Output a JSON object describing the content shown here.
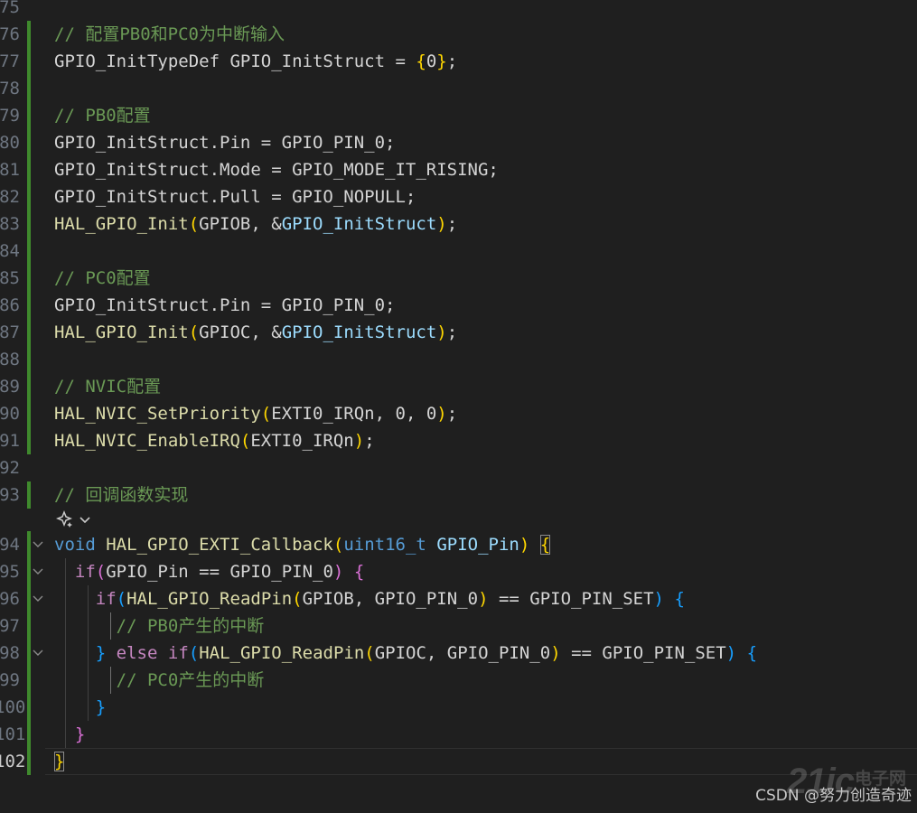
{
  "lines": [
    {
      "n": "75",
      "bar": false,
      "fold": false,
      "guides": [],
      "tokens": []
    },
    {
      "n": "76",
      "bar": true,
      "fold": false,
      "guides": [],
      "tokens": [
        {
          "t": "// 配置PB0和PC0为中断输入",
          "c": "comment"
        }
      ]
    },
    {
      "n": "77",
      "bar": true,
      "fold": false,
      "guides": [],
      "tokens": [
        {
          "t": "GPIO_InitTypeDef GPIO_InitStruct = ",
          "c": "op"
        },
        {
          "t": "{",
          "c": "b1"
        },
        {
          "t": "0",
          "c": "op"
        },
        {
          "t": "}",
          "c": "b1"
        },
        {
          "t": ";",
          "c": "op"
        }
      ]
    },
    {
      "n": "78",
      "bar": true,
      "fold": false,
      "guides": [],
      "tokens": []
    },
    {
      "n": "79",
      "bar": true,
      "fold": false,
      "guides": [],
      "tokens": [
        {
          "t": "// PB0配置",
          "c": "comment"
        }
      ]
    },
    {
      "n": "80",
      "bar": true,
      "fold": false,
      "guides": [],
      "tokens": [
        {
          "t": "GPIO_InitStruct.Pin = GPIO_PIN_0;",
          "c": "op"
        }
      ]
    },
    {
      "n": "81",
      "bar": true,
      "fold": false,
      "guides": [],
      "tokens": [
        {
          "t": "GPIO_InitStruct.Mode = GPIO_MODE_IT_RISING;",
          "c": "op"
        }
      ]
    },
    {
      "n": "82",
      "bar": true,
      "fold": false,
      "guides": [],
      "tokens": [
        {
          "t": "GPIO_InitStruct.Pull = GPIO_NOPULL;",
          "c": "op"
        }
      ]
    },
    {
      "n": "83",
      "bar": true,
      "fold": false,
      "guides": [],
      "tokens": [
        {
          "t": "HAL_GPIO_Init",
          "c": "func"
        },
        {
          "t": "(",
          "c": "b1"
        },
        {
          "t": "GPIOB, &",
          "c": "op"
        },
        {
          "t": "GPIO_InitStruct",
          "c": "var"
        },
        {
          "t": ")",
          "c": "b1"
        },
        {
          "t": ";",
          "c": "op"
        }
      ]
    },
    {
      "n": "84",
      "bar": true,
      "fold": false,
      "guides": [],
      "tokens": []
    },
    {
      "n": "85",
      "bar": true,
      "fold": false,
      "guides": [],
      "tokens": [
        {
          "t": "// PC0配置",
          "c": "comment"
        }
      ]
    },
    {
      "n": "86",
      "bar": true,
      "fold": false,
      "guides": [],
      "tokens": [
        {
          "t": "GPIO_InitStruct.Pin = GPIO_PIN_0;",
          "c": "op"
        }
      ]
    },
    {
      "n": "87",
      "bar": true,
      "fold": false,
      "guides": [],
      "tokens": [
        {
          "t": "HAL_GPIO_Init",
          "c": "func"
        },
        {
          "t": "(",
          "c": "b1"
        },
        {
          "t": "GPIOC, &",
          "c": "op"
        },
        {
          "t": "GPIO_InitStruct",
          "c": "var"
        },
        {
          "t": ")",
          "c": "b1"
        },
        {
          "t": ";",
          "c": "op"
        }
      ]
    },
    {
      "n": "88",
      "bar": true,
      "fold": false,
      "guides": [],
      "tokens": []
    },
    {
      "n": "89",
      "bar": true,
      "fold": false,
      "guides": [],
      "tokens": [
        {
          "t": "// NVIC配置",
          "c": "comment"
        }
      ]
    },
    {
      "n": "90",
      "bar": true,
      "fold": false,
      "guides": [],
      "tokens": [
        {
          "t": "HAL_NVIC_SetPriority",
          "c": "func"
        },
        {
          "t": "(",
          "c": "b1"
        },
        {
          "t": "EXTI0_IRQn, 0, 0",
          "c": "op"
        },
        {
          "t": ")",
          "c": "b1"
        },
        {
          "t": ";",
          "c": "op"
        }
      ]
    },
    {
      "n": "91",
      "bar": true,
      "fold": false,
      "guides": [],
      "tokens": [
        {
          "t": "HAL_NVIC_EnableIRQ",
          "c": "func"
        },
        {
          "t": "(",
          "c": "b1"
        },
        {
          "t": "EXTI0_IRQn",
          "c": "op"
        },
        {
          "t": ")",
          "c": "b1"
        },
        {
          "t": ";",
          "c": "op"
        }
      ]
    },
    {
      "n": "92",
      "bar": false,
      "fold": false,
      "guides": [],
      "tokens": []
    },
    {
      "n": "93",
      "bar": true,
      "fold": false,
      "guides": [],
      "tokens": [
        {
          "t": "// 回调函数实现",
          "c": "comment"
        }
      ]
    },
    {
      "n": "94",
      "bar": true,
      "fold": true,
      "guides": [],
      "tokens": [
        {
          "t": "void",
          "c": "kw"
        },
        {
          "t": " ",
          "c": "op"
        },
        {
          "t": "HAL_GPIO_EXTI_Callback",
          "c": "func"
        },
        {
          "t": "(",
          "c": "b1"
        },
        {
          "t": "uint16_t",
          "c": "kw"
        },
        {
          "t": " ",
          "c": "op"
        },
        {
          "t": "GPIO_Pin",
          "c": "var"
        },
        {
          "t": ")",
          "c": "b1"
        },
        {
          "t": " ",
          "c": "op"
        },
        {
          "t": "{",
          "c": "b1m"
        }
      ]
    },
    {
      "n": "95",
      "bar": true,
      "fold": true,
      "guides": [
        0
      ],
      "tokens": [
        {
          "t": "  ",
          "c": "op"
        },
        {
          "t": "if",
          "c": "ctrl"
        },
        {
          "t": "(",
          "c": "b2"
        },
        {
          "t": "GPIO_Pin == GPIO_PIN_0",
          "c": "op"
        },
        {
          "t": ")",
          "c": "b2"
        },
        {
          "t": " ",
          "c": "op"
        },
        {
          "t": "{",
          "c": "b2"
        }
      ]
    },
    {
      "n": "96",
      "bar": true,
      "fold": true,
      "guides": [
        0,
        1
      ],
      "tokens": [
        {
          "t": "    ",
          "c": "op"
        },
        {
          "t": "if",
          "c": "ctrl"
        },
        {
          "t": "(",
          "c": "b3"
        },
        {
          "t": "HAL_GPIO_ReadPin",
          "c": "func"
        },
        {
          "t": "(",
          "c": "b1"
        },
        {
          "t": "GPIOB, GPIO_PIN_0",
          "c": "op"
        },
        {
          "t": ")",
          "c": "b1"
        },
        {
          "t": " == GPIO_PIN_SET",
          "c": "op"
        },
        {
          "t": ")",
          "c": "b3"
        },
        {
          "t": " ",
          "c": "op"
        },
        {
          "t": "{",
          "c": "b3"
        }
      ]
    },
    {
      "n": "97",
      "bar": true,
      "fold": false,
      "guides": [
        0,
        1,
        2
      ],
      "tokens": [
        {
          "t": "      ",
          "c": "op"
        },
        {
          "t": "// PB0产生的中断",
          "c": "comment"
        }
      ]
    },
    {
      "n": "98",
      "bar": true,
      "fold": true,
      "guides": [
        0,
        1
      ],
      "tokens": [
        {
          "t": "    ",
          "c": "op"
        },
        {
          "t": "}",
          "c": "b3"
        },
        {
          "t": " ",
          "c": "op"
        },
        {
          "t": "else",
          "c": "ctrl"
        },
        {
          "t": " ",
          "c": "op"
        },
        {
          "t": "if",
          "c": "ctrl"
        },
        {
          "t": "(",
          "c": "b3"
        },
        {
          "t": "HAL_GPIO_ReadPin",
          "c": "func"
        },
        {
          "t": "(",
          "c": "b1"
        },
        {
          "t": "GPIOC, GPIO_PIN_0",
          "c": "op"
        },
        {
          "t": ")",
          "c": "b1"
        },
        {
          "t": " == GPIO_PIN_SET",
          "c": "op"
        },
        {
          "t": ")",
          "c": "b3"
        },
        {
          "t": " ",
          "c": "op"
        },
        {
          "t": "{",
          "c": "b3"
        }
      ]
    },
    {
      "n": "99",
      "bar": true,
      "fold": false,
      "guides": [
        0,
        1,
        2
      ],
      "tokens": [
        {
          "t": "      ",
          "c": "op"
        },
        {
          "t": "// PC0产生的中断",
          "c": "comment"
        }
      ]
    },
    {
      "n": "100",
      "bar": true,
      "fold": false,
      "guides": [
        0,
        1
      ],
      "tokens": [
        {
          "t": "    ",
          "c": "op"
        },
        {
          "t": "}",
          "c": "b3"
        }
      ]
    },
    {
      "n": "101",
      "bar": true,
      "fold": false,
      "guides": [
        0
      ],
      "tokens": [
        {
          "t": "  ",
          "c": "op"
        },
        {
          "t": "}",
          "c": "b2"
        }
      ]
    },
    {
      "n": "102",
      "bar": true,
      "fold": false,
      "guides": [],
      "active": true,
      "tokens": [
        {
          "t": "}",
          "c": "b1m"
        }
      ]
    }
  ],
  "watermark": {
    "logo": "21ic",
    "logo_cn": "电子网",
    "text": "CSDN @努力创造奇迹"
  }
}
